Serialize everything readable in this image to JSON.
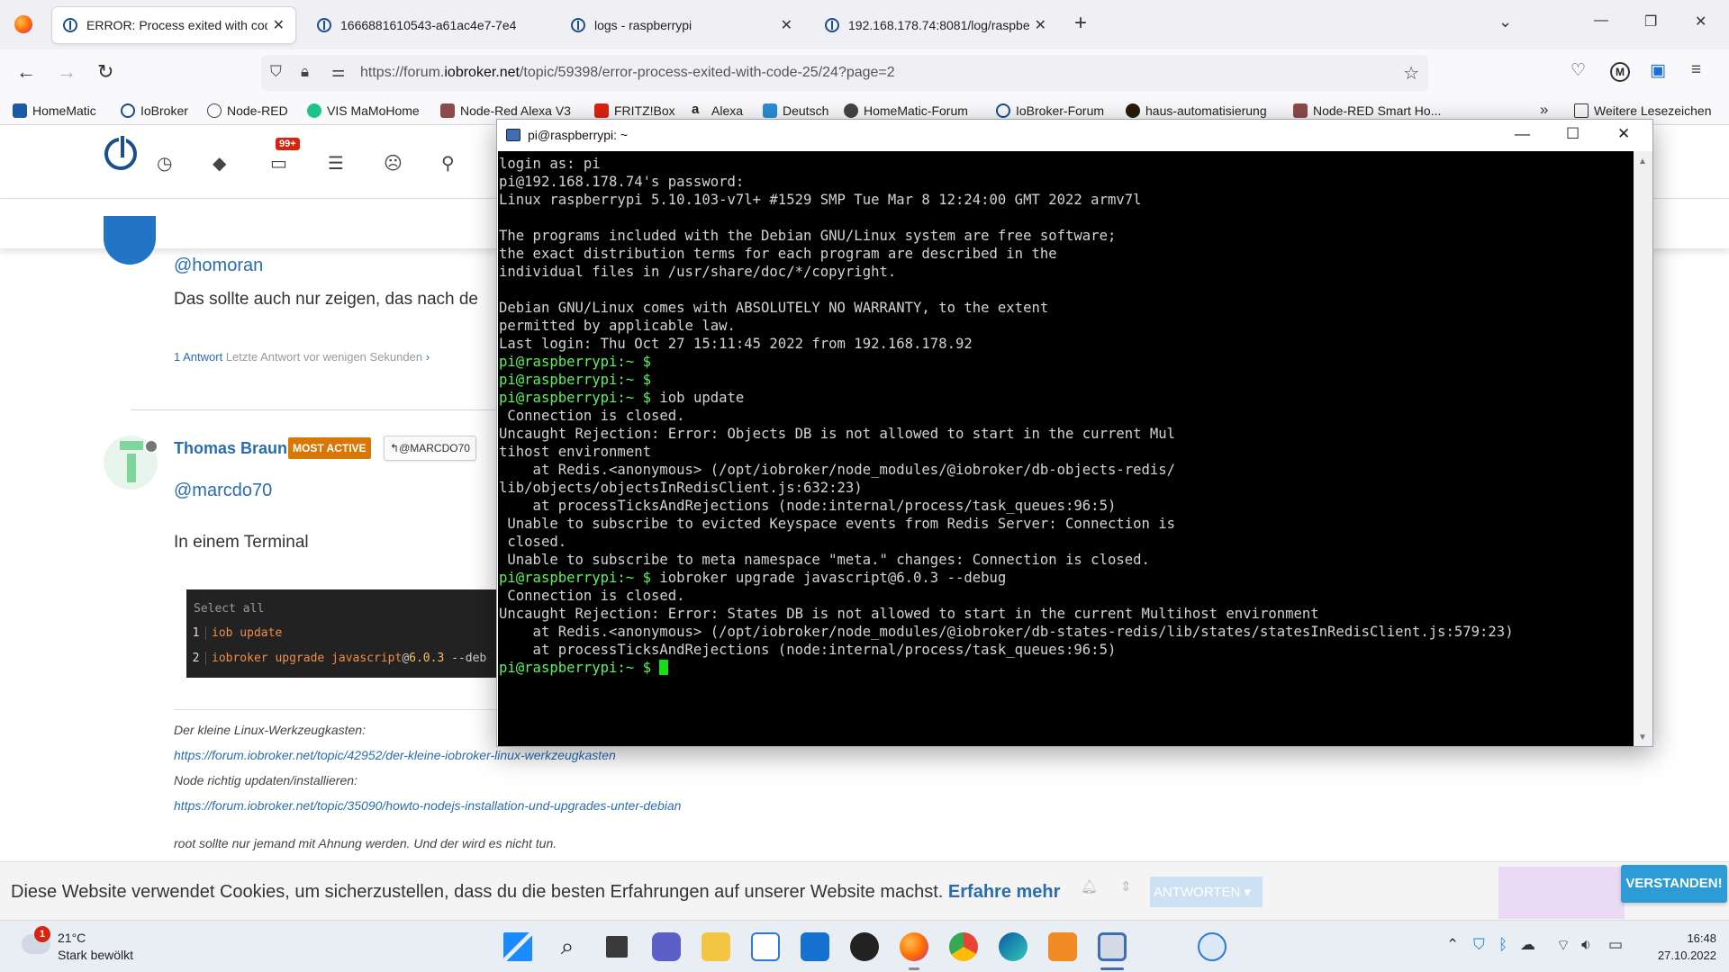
{
  "browser": {
    "tabs": [
      {
        "title": "ERROR: Process exited with code",
        "active": true
      },
      {
        "title": "1666881610543-a61ac4e7-7e4",
        "active": false
      },
      {
        "title": "logs - raspberrypi",
        "active": false
      },
      {
        "title": "192.168.178.74:8081/log/raspbe",
        "active": false
      }
    ],
    "url_prefix": "https://forum.",
    "url_domain": "iobroker.net",
    "url_path": "/topic/59398/error-process-exited-with-code-25/24?page=2",
    "profile_initial": "M",
    "bookmarks": [
      "HomeMatic",
      "IoBroker",
      "Node-RED",
      "VIS MaMoHome",
      "Node-Red Alexa V3",
      "FRITZ!Box",
      "Alexa",
      "Deutsch",
      "HomeMatic-Forum",
      "IoBroker-Forum",
      "haus-automatisierung",
      "Node-RED Smart Ho..."
    ],
    "bookmarks_more": "Weitere Lesezeichen"
  },
  "forum": {
    "notification_badge": "99+",
    "post1": {
      "mention": "@homoran",
      "text": "Das sollte auch nur zeigen, das nach de",
      "reply_count": "1 Antwort",
      "reply_time": "Letzte Antwort vor wenigen Sekunden"
    },
    "post2": {
      "author": "Thomas Braun",
      "badge": "MOST ACTIVE",
      "reply_to": "@MARCDO70",
      "mention": "@marcdo70",
      "text": "In einem Terminal",
      "code": {
        "header": "Select all",
        "lines": [
          {
            "num": "1",
            "cmd": "iob update"
          },
          {
            "num": "2",
            "cmd": "iobroker upgrade javascript",
            "at": "@",
            "ver": "6.0.3",
            "rest": " --deb"
          }
        ]
      },
      "signature": [
        {
          "text": "Der kleine Linux-Werkzeugkasten:",
          "link": false
        },
        {
          "text": "https://forum.iobroker.net/topic/42952/der-kleine-iobroker-linux-werkzeugkasten",
          "link": true
        },
        {
          "text": "Node richtig updaten/installieren:",
          "link": false
        },
        {
          "text": "https://forum.iobroker.net/topic/35090/howto-nodejs-installation-und-upgrades-unter-debian",
          "link": true
        },
        {
          "text": "root sollte nur jemand mit Ahnung werden. Und der wird es nicht tun.",
          "link": false
        }
      ]
    },
    "cookie": {
      "text": "Diese Website verwendet Cookies, um sicherzustellen, dass du die besten Erfahrungen auf unserer Website machst.",
      "link": "Erfahre mehr",
      "accept": "VERSTANDEN!",
      "reply_button": "ANTWORTEN"
    }
  },
  "putty": {
    "title": "pi@raspberrypi: ~",
    "prompt": "pi@raspberrypi:~ $",
    "lines": [
      {
        "type": "out",
        "text": "login as: pi"
      },
      {
        "type": "out",
        "text": "pi@192.168.178.74's password:"
      },
      {
        "type": "out",
        "text": "Linux raspberrypi 5.10.103-v7l+ #1529 SMP Tue Mar 8 12:24:00 GMT 2022 armv7l"
      },
      {
        "type": "out",
        "text": ""
      },
      {
        "type": "out",
        "text": "The programs included with the Debian GNU/Linux system are free software;"
      },
      {
        "type": "out",
        "text": "the exact distribution terms for each program are described in the"
      },
      {
        "type": "out",
        "text": "individual files in /usr/share/doc/*/copyright."
      },
      {
        "type": "out",
        "text": ""
      },
      {
        "type": "out",
        "text": "Debian GNU/Linux comes with ABSOLUTELY NO WARRANTY, to the extent"
      },
      {
        "type": "out",
        "text": "permitted by applicable law."
      },
      {
        "type": "out",
        "text": "Last login: Thu Oct 27 15:11:45 2022 from 192.168.178.92"
      },
      {
        "type": "prompt",
        "text": ""
      },
      {
        "type": "prompt",
        "text": ""
      },
      {
        "type": "prompt",
        "text": " iob update"
      },
      {
        "type": "out",
        "text": " Connection is closed."
      },
      {
        "type": "out",
        "text": "Uncaught Rejection: Error: Objects DB is not allowed to start in the current Mul"
      },
      {
        "type": "out",
        "text": "tihost environment"
      },
      {
        "type": "out",
        "text": "    at Redis.<anonymous> (/opt/iobroker/node_modules/@iobroker/db-objects-redis/"
      },
      {
        "type": "out",
        "text": "lib/objects/objectsInRedisClient.js:632:23)"
      },
      {
        "type": "out",
        "text": "    at processTicksAndRejections (node:internal/process/task_queues:96:5)"
      },
      {
        "type": "out",
        "text": " Unable to subscribe to evicted Keyspace events from Redis Server: Connection is"
      },
      {
        "type": "out",
        "text": " closed."
      },
      {
        "type": "out",
        "text": " Unable to subscribe to meta namespace \"meta.\" changes: Connection is closed."
      },
      {
        "type": "prompt",
        "text": " iobroker upgrade javascript@6.0.3 --debug"
      },
      {
        "type": "out",
        "text": " Connection is closed."
      },
      {
        "type": "out",
        "text": "Uncaught Rejection: Error: States DB is not allowed to start in the current Multihost environment"
      },
      {
        "type": "out",
        "text": "    at Redis.<anonymous> (/opt/iobroker/node_modules/@iobroker/db-states-redis/lib/states/statesInRedisClient.js:579:23)"
      },
      {
        "type": "out",
        "text": "    at processTicksAndRejections (node:internal/process/task_queues:96:5)"
      },
      {
        "type": "cursor",
        "text": " "
      }
    ]
  },
  "taskbar": {
    "weather_badge": "1",
    "temperature": "21°C",
    "weather": "Stark bewölkt",
    "time": "16:48",
    "date": "27.10.2022"
  },
  "colors": {
    "terminal_bg": "#000000",
    "terminal_text": "#d3d3d3",
    "prompt_green": "#5ef25e",
    "forum_link": "#2b6cb0",
    "most_active_badge": "#d97706",
    "accept_button": "#2c9bd6"
  }
}
